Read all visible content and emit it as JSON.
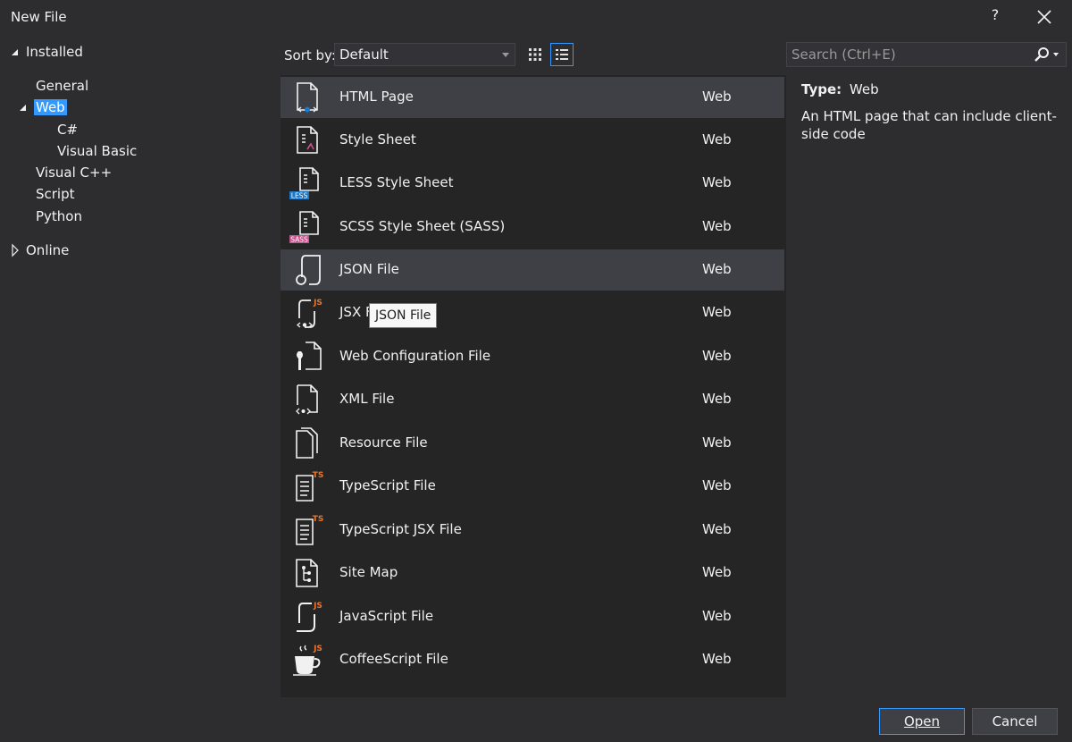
{
  "window": {
    "title": "New File",
    "help_label": "?"
  },
  "tree": {
    "installed": "Installed",
    "items": [
      {
        "label": "General"
      },
      {
        "label": "Web",
        "selected": true
      },
      {
        "label": "C#"
      },
      {
        "label": "Visual Basic"
      },
      {
        "label": "Visual C++"
      },
      {
        "label": "Script"
      },
      {
        "label": "Python"
      }
    ],
    "online": "Online"
  },
  "toolbar": {
    "sort_label": "Sort by:",
    "sort_value": "Default"
  },
  "search": {
    "placeholder": "Search (Ctrl+E)"
  },
  "templates": [
    {
      "name": "HTML Page",
      "category": "Web",
      "icon": "html-page-icon"
    },
    {
      "name": "Style Sheet",
      "category": "Web",
      "icon": "style-sheet-icon"
    },
    {
      "name": "LESS Style Sheet",
      "category": "Web",
      "icon": "less-style-sheet-icon",
      "badge": "LESS"
    },
    {
      "name": "SCSS Style Sheet (SASS)",
      "category": "Web",
      "icon": "scss-style-sheet-icon",
      "badge": "SASS"
    },
    {
      "name": "JSON File",
      "category": "Web",
      "icon": "json-file-icon"
    },
    {
      "name": "JSX F",
      "category": "Web",
      "icon": "jsx-file-icon",
      "badge": "JS"
    },
    {
      "name": "Web Configuration File",
      "category": "Web",
      "icon": "web-config-file-icon"
    },
    {
      "name": "XML File",
      "category": "Web",
      "icon": "xml-file-icon"
    },
    {
      "name": "Resource File",
      "category": "Web",
      "icon": "resource-file-icon"
    },
    {
      "name": "TypeScript File",
      "category": "Web",
      "icon": "typescript-file-icon",
      "badge": "TS"
    },
    {
      "name": "TypeScript JSX File",
      "category": "Web",
      "icon": "typescript-jsx-file-icon",
      "badge": "TS"
    },
    {
      "name": "Site Map",
      "category": "Web",
      "icon": "site-map-icon"
    },
    {
      "name": "JavaScript File",
      "category": "Web",
      "icon": "javascript-file-icon",
      "badge": "JS"
    },
    {
      "name": "CoffeeScript File",
      "category": "Web",
      "icon": "coffeescript-file-icon",
      "badge": "JS"
    }
  ],
  "tooltip": "JSON File",
  "details": {
    "type_key": "Type:",
    "type_value": "Web",
    "description": "An HTML page that can include client-side code"
  },
  "buttons": {
    "open": "Open",
    "cancel": "Cancel"
  },
  "colors": {
    "accent": "#3399ff",
    "background": "#2d2d30",
    "list_background": "#252526",
    "selection": "#3f3f46",
    "badge_orange": "#e8762d",
    "badge_blue": "#1e78c8",
    "badge_pink": "#c6538c"
  }
}
